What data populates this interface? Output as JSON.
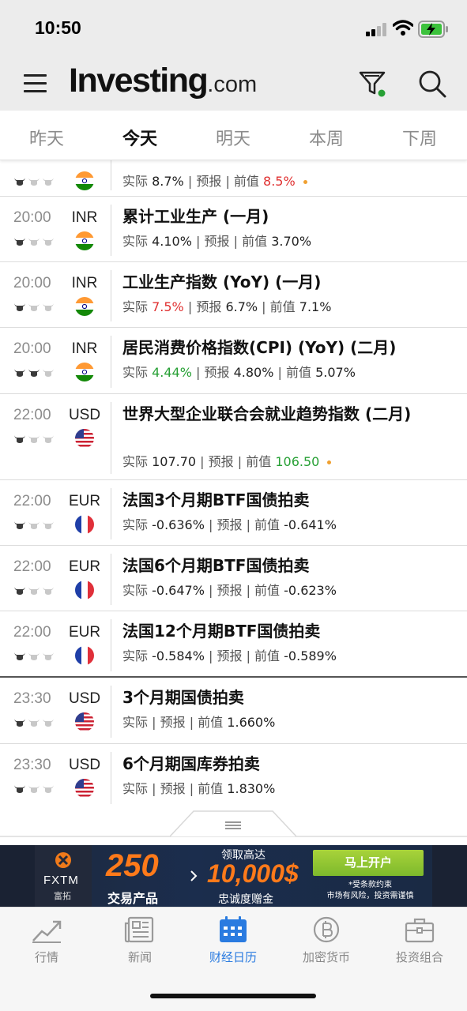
{
  "status_bar": {
    "time": "10:50",
    "signal_icon": "signal-icon",
    "wifi_icon": "wifi-icon",
    "battery_icon": "battery-charging-icon"
  },
  "header": {
    "logo_main": "Investing",
    "logo_suffix": ".com",
    "menu_icon": "menu-icon",
    "filter_icon": "filter-icon",
    "search_icon": "search-icon",
    "filter_active_color": "#27a035"
  },
  "tabs": [
    {
      "label": "昨天"
    },
    {
      "label": "今天",
      "active": true
    },
    {
      "label": "明天"
    },
    {
      "label": "本周"
    },
    {
      "label": "下周"
    }
  ],
  "events": [
    {
      "time": "",
      "currency": "",
      "flag": "india",
      "importance": 1,
      "title": "",
      "actual_label": "实际",
      "actual": "8.7%",
      "actual_color": "",
      "forecast_label": "预报",
      "forecast": "",
      "previous_label": "前值",
      "previous": "8.5%",
      "previous_color": "red",
      "revised_dot": true
    },
    {
      "time": "20:00",
      "currency": "INR",
      "flag": "india",
      "importance": 1,
      "title": "累计工业生产 (一月)",
      "actual_label": "实际",
      "actual": "4.10%",
      "actual_color": "",
      "forecast_label": "预报",
      "forecast": "",
      "previous_label": "前值",
      "previous": "3.70%",
      "previous_color": "",
      "revised_dot": false
    },
    {
      "time": "20:00",
      "currency": "INR",
      "flag": "india",
      "importance": 1,
      "title": "工业生产指数 (YoY) (一月)",
      "actual_label": "实际",
      "actual": "7.5%",
      "actual_color": "red",
      "forecast_label": "预报",
      "forecast": "6.7%",
      "previous_label": "前值",
      "previous": "7.1%",
      "previous_color": "",
      "revised_dot": false
    },
    {
      "time": "20:00",
      "currency": "INR",
      "flag": "india",
      "importance": 2,
      "title": "居民消费价格指数(CPI) (YoY) (二月)",
      "actual_label": "实际",
      "actual": "4.44%",
      "actual_color": "green",
      "forecast_label": "预报",
      "forecast": "4.80%",
      "previous_label": "前值",
      "previous": "5.07%",
      "previous_color": "",
      "revised_dot": false
    },
    {
      "time": "22:00",
      "currency": "USD",
      "flag": "usa",
      "importance": 1,
      "title": "世界大型企业联合会就业趋势指数 (二月)",
      "actual_label": "实际",
      "actual": "107.70",
      "actual_color": "",
      "forecast_label": "预报",
      "forecast": "",
      "previous_label": "前值",
      "previous": "106.50",
      "previous_color": "green",
      "revised_dot": true
    },
    {
      "time": "22:00",
      "currency": "EUR",
      "flag": "france",
      "importance": 1,
      "title": "法国3个月期BTF国债拍卖",
      "actual_label": "实际",
      "actual": "-0.636%",
      "actual_color": "",
      "forecast_label": "预报",
      "forecast": "",
      "previous_label": "前值",
      "previous": "-0.641%",
      "previous_color": "",
      "revised_dot": false
    },
    {
      "time": "22:00",
      "currency": "EUR",
      "flag": "france",
      "importance": 1,
      "title": "法国6个月期BTF国债拍卖",
      "actual_label": "实际",
      "actual": "-0.647%",
      "actual_color": "",
      "forecast_label": "预报",
      "forecast": "",
      "previous_label": "前值",
      "previous": "-0.623%",
      "previous_color": "",
      "revised_dot": false
    },
    {
      "time": "22:00",
      "currency": "EUR",
      "flag": "france",
      "importance": 1,
      "title": "法国12个月期BTF国债拍卖",
      "actual_label": "实际",
      "actual": "-0.584%",
      "actual_color": "",
      "forecast_label": "预报",
      "forecast": "",
      "previous_label": "前值",
      "previous": "-0.589%",
      "previous_color": "",
      "revised_dot": false
    },
    {
      "time": "23:30",
      "currency": "USD",
      "flag": "usa",
      "importance": 1,
      "title": "3个月期国债拍卖",
      "actual_label": "实际",
      "actual": "",
      "actual_color": "",
      "forecast_label": "预报",
      "forecast": "",
      "previous_label": "前值",
      "previous": "1.660%",
      "previous_color": "",
      "revised_dot": false
    },
    {
      "time": "23:30",
      "currency": "USD",
      "flag": "usa",
      "importance": 1,
      "title": "6个月期国库券拍卖",
      "actual_label": "实际",
      "actual": "",
      "actual_color": "",
      "forecast_label": "预报",
      "forecast": "",
      "previous_label": "前值",
      "previous": "1.830%",
      "previous_color": "",
      "revised_dot": false
    }
  ],
  "ad": {
    "brand": "FXTM",
    "brand_sub": "富拓",
    "big_number": "250",
    "big_number_sub": "交易产品",
    "mid_top": "领取高达",
    "mid_big": "10,000$",
    "mid_sub": "忠诚度赠金",
    "cta": "马上开户",
    "note_line1": "*受条款约束",
    "note_line2": "市场有风险，投资需谨慎"
  },
  "bottom_nav": [
    {
      "label": "行情",
      "icon": "chart-icon"
    },
    {
      "label": "新闻",
      "icon": "news-icon"
    },
    {
      "label": "财经日历",
      "icon": "calendar-icon",
      "active": true
    },
    {
      "label": "加密货币",
      "icon": "bitcoin-icon"
    },
    {
      "label": "投资组合",
      "icon": "briefcase-icon"
    }
  ],
  "colors": {
    "red": "#e03131",
    "green": "#27a035",
    "active_blue": "#2a7be0",
    "dot": "#f0a030"
  }
}
